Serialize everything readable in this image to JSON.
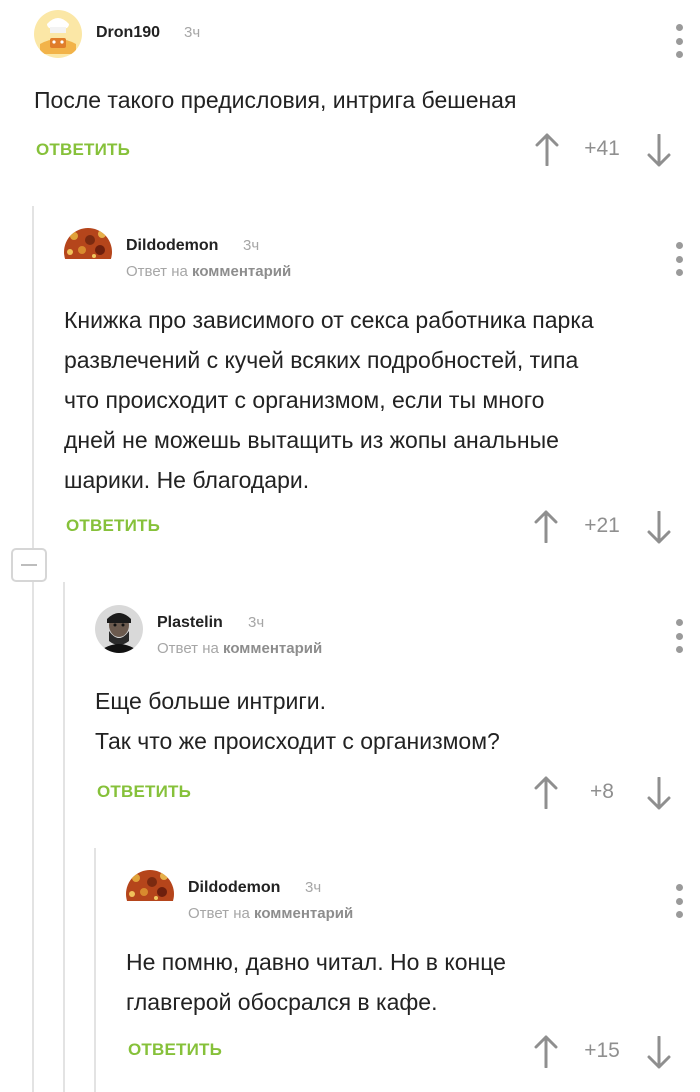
{
  "comments": [
    {
      "username": "Dron190",
      "time": "3ч",
      "text_lines": [
        "После такого предисловия, интрига бешеная"
      ],
      "reply_label": "ОТВЕТИТЬ",
      "rating": "+41"
    },
    {
      "username": "Dildodemon",
      "time": "3ч",
      "reply_to_prefix": "Ответ на",
      "reply_to_target": "комментарий",
      "text_lines": [
        "Книжка про зависимого от секса работника парка",
        "развлечений с кучей всяких подробностей, типа",
        "что происходит с организмом, если ты много",
        "дней не можешь вытащить из жопы анальные",
        "шарики. Не благодари."
      ],
      "reply_label": "ОТВЕТИТЬ",
      "rating": "+21"
    },
    {
      "username": "Plastelin",
      "time": "3ч",
      "reply_to_prefix": "Ответ на",
      "reply_to_target": "комментарий",
      "text_lines": [
        "Еще больше интриги.",
        "Так что же происходит с организмом?"
      ],
      "reply_label": "ОТВЕТИТЬ",
      "rating": "+8"
    },
    {
      "username": "Dildodemon",
      "time": "3ч",
      "reply_to_prefix": "Ответ на",
      "reply_to_target": "комментарий",
      "text_lines": [
        "Не помню, давно читал. Но в конце",
        "главгерой обосрался в кафе."
      ],
      "reply_label": "ОТВЕТИТЬ",
      "rating": "+15"
    }
  ],
  "colors": {
    "reply": "#86c13a",
    "meta": "#a6a6a6",
    "text": "#222222",
    "thread_line": "#e3e3e3"
  },
  "icons": {
    "upvote": "arrow-up-icon",
    "downvote": "arrow-down-icon",
    "menu": "more-vertical-icon",
    "collapse": "minus-icon"
  }
}
